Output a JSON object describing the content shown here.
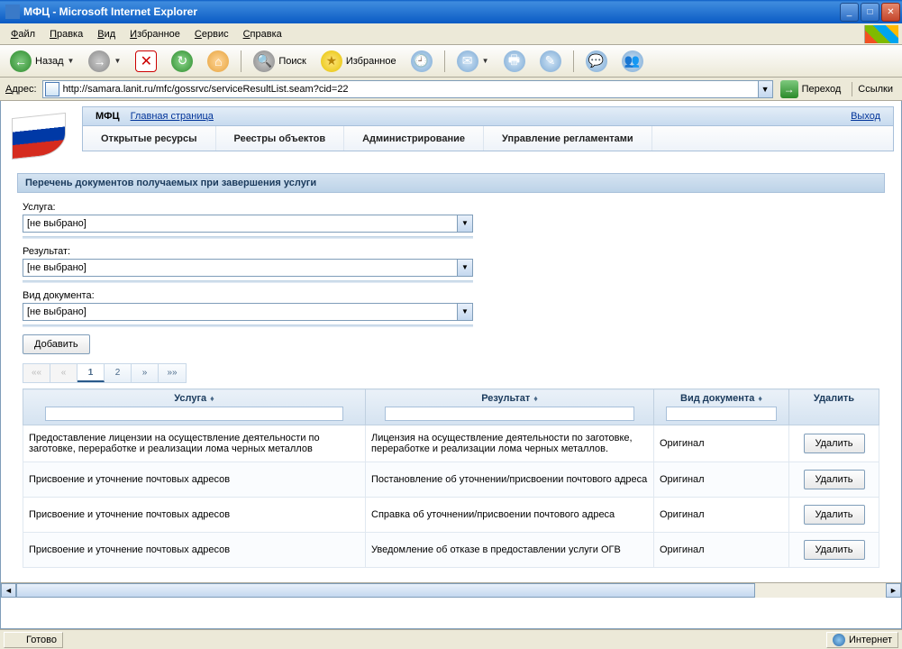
{
  "window": {
    "title": "МФЦ - Microsoft Internet Explorer"
  },
  "menubar": {
    "file": "Файл",
    "edit": "Правка",
    "view": "Вид",
    "favorites": "Избранное",
    "tools": "Сервис",
    "help": "Справка"
  },
  "toolbar": {
    "back": "Назад",
    "search": "Поиск",
    "favorites": "Избранное"
  },
  "addressbar": {
    "label": "Адрес:",
    "url": "http://samara.lanit.ru/mfc/gossrvc/serviceResultList.seam?cid=22",
    "go": "Переход",
    "links": "Ссылки"
  },
  "breadcrumb": {
    "mfc": "МФЦ",
    "home": "Главная страница",
    "exit": "Выход"
  },
  "mainnav": {
    "n1": "Открытые ресурсы",
    "n2": "Реестры объектов",
    "n3": "Администрирование",
    "n4": "Управление регламентами"
  },
  "section": {
    "title": "Перечень документов получаемых при завершения услуги"
  },
  "form": {
    "service_label": "Услуга:",
    "service_value": "[не выбрано]",
    "result_label": "Результат:",
    "result_value": "[не выбрано]",
    "doctype_label": "Вид документа:",
    "doctype_value": "[не выбрано]",
    "add": "Добавить"
  },
  "pager": {
    "first": "««",
    "prev": "«",
    "p1": "1",
    "p2": "2",
    "next": "»",
    "last": "»»"
  },
  "grid": {
    "h_service": "Услуга",
    "h_result": "Результат",
    "h_doctype": "Вид документа",
    "h_delete": "Удалить",
    "rows": [
      {
        "service": "Предоставление лицензии на осуществление деятельности по заготовке, переработке и реализации лома черных металлов",
        "result": "Лицензия на осуществление деятельности по заготовке, переработке и реализации лома черных металлов.",
        "doctype": "Оригинал",
        "delete": "Удалить"
      },
      {
        "service": "Присвоение и уточнение почтовых адресов",
        "result": "Постановление об уточнении/присвоении почтового адреса",
        "doctype": "Оригинал",
        "delete": "Удалить"
      },
      {
        "service": "Присвоение и уточнение почтовых адресов",
        "result": "Справка об уточнении/присвоении почтового адреса",
        "doctype": "Оригинал",
        "delete": "Удалить"
      },
      {
        "service": "Присвоение и уточнение почтовых адресов",
        "result": "Уведомление об отказе в предоставлении услуги ОГВ",
        "doctype": "Оригинал",
        "delete": "Удалить"
      }
    ]
  },
  "statusbar": {
    "ready": "Готово",
    "zone": "Интернет"
  }
}
